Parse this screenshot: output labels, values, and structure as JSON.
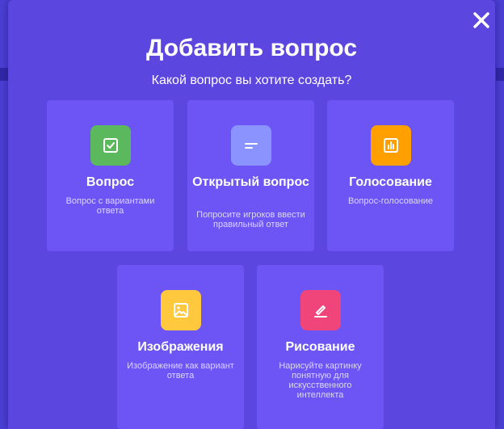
{
  "dialog": {
    "title": "Добавить вопрос",
    "subtitle": "Какой вопрос вы хотите создать?",
    "close_icon": "close-icon"
  },
  "cards": [
    {
      "title": "Вопрос",
      "description": "Вопрос с вариантами ответа",
      "icon": "checkbox-icon",
      "color": "#5cb85c"
    },
    {
      "title": "Открытый вопрос",
      "description": "Попросите игроков ввести правильный ответ",
      "icon": "text-lines-icon",
      "color": "#8b93ff"
    },
    {
      "title": "Голосование",
      "description": "Вопрос-голосование",
      "icon": "bar-chart-icon",
      "color": "#ff9f00"
    },
    {
      "title": "Изображения",
      "description": "Изображение как вариант ответа",
      "icon": "image-icon",
      "color": "#ffc83d"
    },
    {
      "title": "Рисование",
      "description": "Нарисуйте картинку понятную для искусственного интеллекта",
      "icon": "pen-icon",
      "color": "#f0457a"
    }
  ],
  "colors": {
    "background": "#4a3fd4",
    "modal": "#5b47e0",
    "card": "#6c54f5"
  }
}
